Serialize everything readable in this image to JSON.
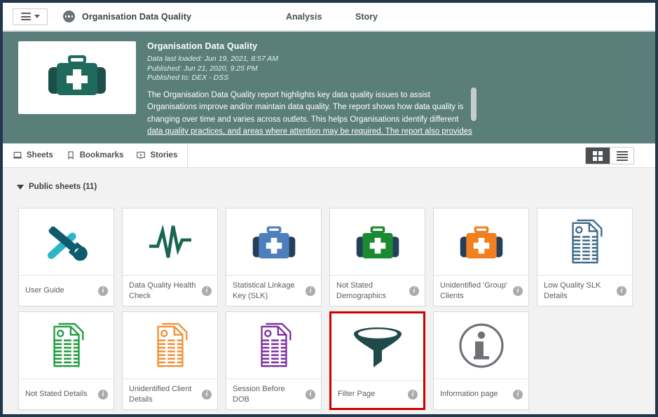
{
  "topbar": {
    "menu_icon": "hamburger-icon",
    "menu_caret_icon": "chevron-down-icon",
    "app_icon": "app-dots-icon",
    "app_title": "Organisation Data Quality",
    "nav": [
      {
        "label": "Analysis",
        "name": "nav-analysis"
      },
      {
        "label": "Story",
        "name": "nav-story"
      }
    ]
  },
  "banner": {
    "thumbnail_icon": "medical-bag-icon",
    "thumbnail_color": "#1e6b5e",
    "background_color": "#5a7e79",
    "title": "Organisation Data Quality",
    "meta": [
      "Data last loaded: Jun 19, 2021, 8:57 AM",
      "Published: Jun 21, 2020, 9:25 PM",
      "Published to: DEX - DSS"
    ],
    "description_lines": [
      "The Organisation Data Quality report highlights key data quality issues to assist",
      "Organisations improve and/or maintain data quality. The report shows how data quality is",
      "changing over time and varies across outlets. This helps Organisations identify different",
      "data quality practices, and areas where attention may be required. The report also provides"
    ],
    "scrollbar": "vertical-scrollbar"
  },
  "tabs": [
    {
      "label": "Sheets",
      "icon": "sheets-icon",
      "name": "tab-sheets"
    },
    {
      "label": "Bookmarks",
      "icon": "bookmark-icon",
      "name": "tab-bookmarks"
    },
    {
      "label": "Stories",
      "icon": "stories-icon",
      "name": "tab-stories"
    }
  ],
  "view_toggle": {
    "grid_icon": "grid-view-icon",
    "list_icon": "list-view-icon",
    "active": "grid"
  },
  "section": {
    "caret_icon": "caret-down-icon",
    "title": "Public sheets (11)"
  },
  "sheets": [
    {
      "label": "User Guide",
      "icon": "tools-icon",
      "color": "#0f5b6e",
      "accent": "#2cb5c7",
      "selected": false
    },
    {
      "label": "Data Quality Health Check",
      "icon": "heartbeat-icon",
      "color": "#1a6450",
      "accent": "#1a6450",
      "selected": false
    },
    {
      "label": "Statistical Linkage Key (SLK)",
      "icon": "medical-bag-icon",
      "color": "#4d7fbd",
      "accent": "#253f59",
      "selected": false
    },
    {
      "label": "Not Stated Demographics",
      "icon": "medical-bag-icon",
      "color": "#1c8a32",
      "accent": "#253f59",
      "selected": false
    },
    {
      "label": "Unidentified 'Group' Clients",
      "icon": "medical-bag-icon",
      "color": "#f08020",
      "accent": "#253f59",
      "selected": false
    },
    {
      "label": "Low Quality SLK Details",
      "icon": "report-docs-icon",
      "color": "#3e6a88",
      "accent": "#3e6a88",
      "selected": false
    },
    {
      "label": "Not Stated Details",
      "icon": "report-docs-icon",
      "color": "#1d9c3c",
      "accent": "#1d9c3c",
      "selected": false
    },
    {
      "label": "Unidentified Client Details",
      "icon": "report-docs-icon",
      "color": "#f0903a",
      "accent": "#f0903a",
      "selected": false
    },
    {
      "label": "Session Before DOB",
      "icon": "report-docs-icon",
      "color": "#7b2fa0",
      "accent": "#7b2fa0",
      "selected": false
    },
    {
      "label": "Filter Page",
      "icon": "funnel-icon",
      "color": "#1f4a4a",
      "accent": "#1f4a4a",
      "selected": true
    },
    {
      "label": "Information page",
      "icon": "info-circle-icon",
      "color": "#6e7276",
      "accent": "#6e7276",
      "selected": false
    }
  ],
  "info_icon_glyph": "i",
  "selection_highlight_color": "#cc0000"
}
